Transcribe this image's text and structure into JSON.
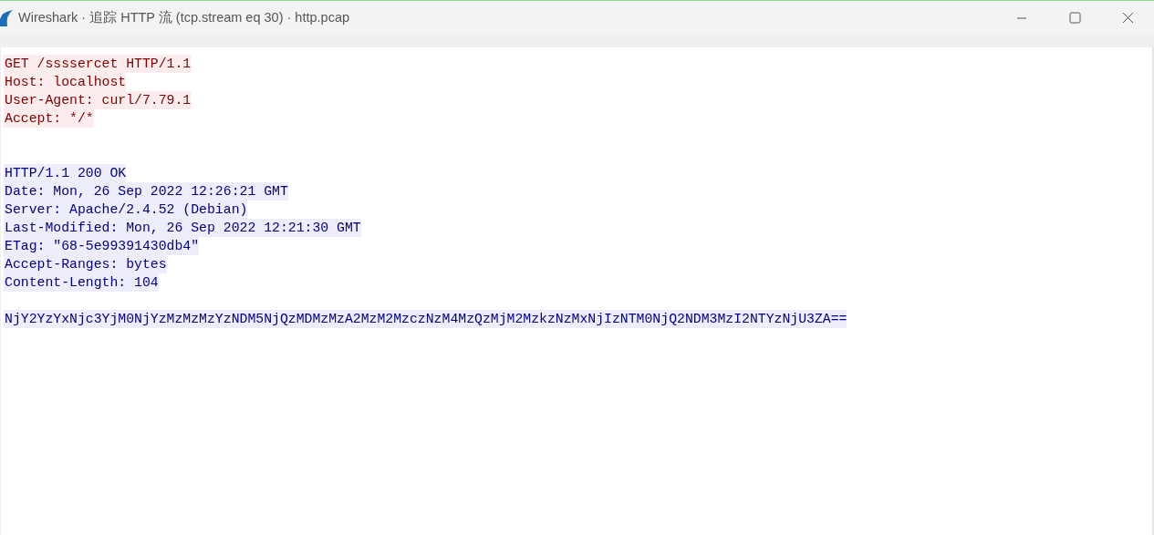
{
  "window": {
    "title": "Wireshark · 追踪 HTTP 流 (tcp.stream eq 30) · http.pcap"
  },
  "stream": [
    {
      "kind": "client",
      "lines": [
        "GET /ssssercet HTTP/1.1",
        "Host: localhost",
        "User-Agent: curl/7.79.1",
        "Accept: */*"
      ]
    },
    {
      "kind": "server",
      "lines": [
        "HTTP/1.1 200 OK",
        "Date: Mon, 26 Sep 2022 12:26:21 GMT",
        "Server: Apache/2.4.52 (Debian)",
        "Last-Modified: Mon, 26 Sep 2022 12:21:30 GMT",
        "ETag: \"68-5e99391430db4\"",
        "Accept-Ranges: bytes",
        "Content-Length: 104"
      ]
    },
    {
      "kind": "server",
      "lines": [
        "NjY2YzYxNjc3YjM0NjYzMzMzMzYzNDM5NjQzMDMzMzA2MzM2MzczNzM4MzQzMjM2MzkzNzMxNjIzNTM0NjQ2NDM3MzI2NTYzNjU3ZA=="
      ]
    }
  ]
}
